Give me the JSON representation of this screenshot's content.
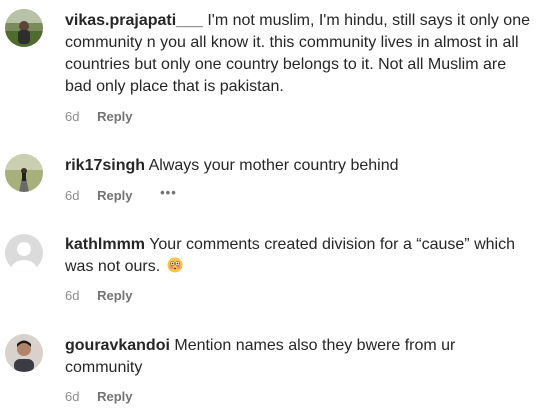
{
  "comments": [
    {
      "username": "vikas.prajapati___",
      "text": "I'm not muslim, I'm hindu, still says it only one community n you all know it. this community lives in almost in all countries but only one country belongs to it. Not all Muslim are bad only place that is pakistan.",
      "time": "6d",
      "reply_label": "Reply",
      "avatar_icon": "avatar-photo-person-outdoors"
    },
    {
      "username": "rik17singh",
      "text": "Always your mother country behind",
      "time": "6d",
      "reply_label": "Reply",
      "more_label": "•••",
      "avatar_icon": "avatar-photo-person-on-road"
    },
    {
      "username": "kathlmmm",
      "text": "Your comments created division for a “cause” which was not ours.",
      "emoji": "flushed-face-emoji",
      "time": "6d",
      "reply_label": "Reply",
      "avatar_icon": "default-avatar-silhouette"
    },
    {
      "username": "gouravkandoi",
      "text": "Mention names also they bwere from ur community",
      "time": "6d",
      "reply_label": "Reply",
      "avatar_icon": "avatar-photo-person-portrait"
    }
  ],
  "colors": {
    "text": "#262626",
    "meta": "#8e8e8e",
    "avatar_default_bg": "#dbdbdb"
  }
}
